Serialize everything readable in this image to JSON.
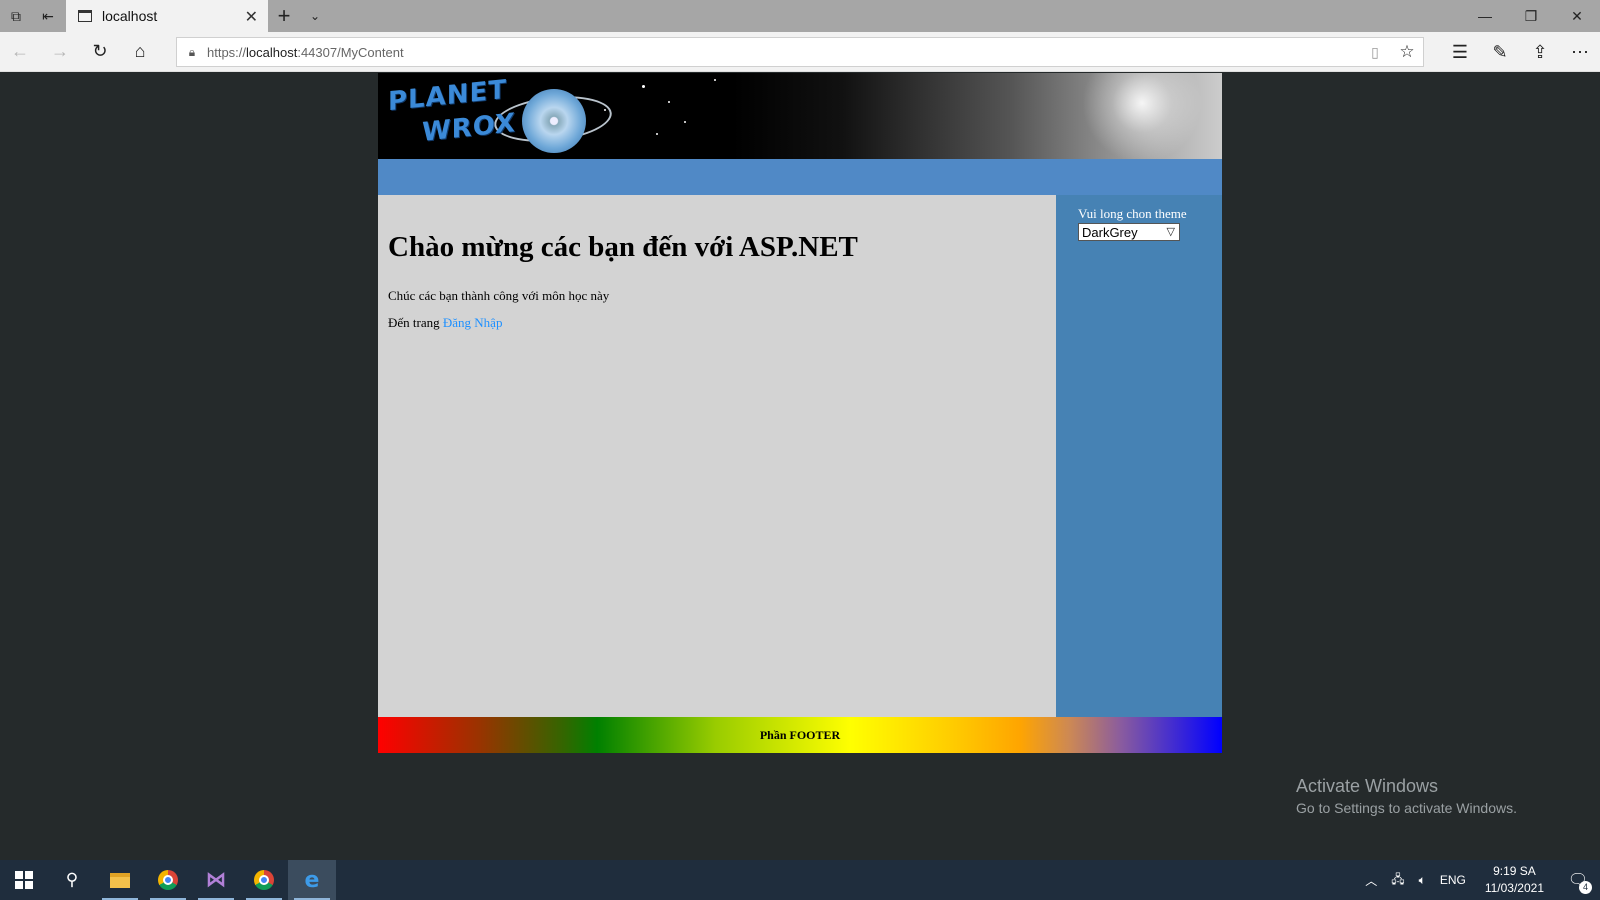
{
  "browser": {
    "tab_title": "localhost",
    "url_prefix": "https://",
    "url_host": "localhost",
    "url_rest": ":44307/MyContent"
  },
  "page": {
    "heading": "Chào mừng các bạn đến với ASP.NET",
    "paragraph": "Chúc các bạn thành công với môn học này",
    "goto_prefix": "Đến trang",
    "login_link": "Đăng Nhập",
    "logo_line1": "PLANET",
    "logo_line2": "WROX",
    "sidebar": {
      "theme_label": "Vui long chon theme",
      "theme_selected": "DarkGrey"
    },
    "footer": "Phần FOOTER",
    "colors": {
      "menubar": "#5089c6",
      "content_bg": "#d3d3d3",
      "sidebar_bg": "#4682b4",
      "link": "#1e90ff",
      "page_bg": "#252a2b"
    }
  },
  "watermark": {
    "line1": "Activate Windows",
    "line2": "Go to Settings to activate Windows."
  },
  "taskbar": {
    "apps": [
      "start-icon",
      "search-icon",
      "file-explorer-icon",
      "chrome-icon",
      "visual-studio-icon",
      "chrome-icon",
      "edge-icon"
    ],
    "language": "ENG",
    "time": "9:19 SA",
    "date": "11/03/2021",
    "notification_count": "4"
  }
}
